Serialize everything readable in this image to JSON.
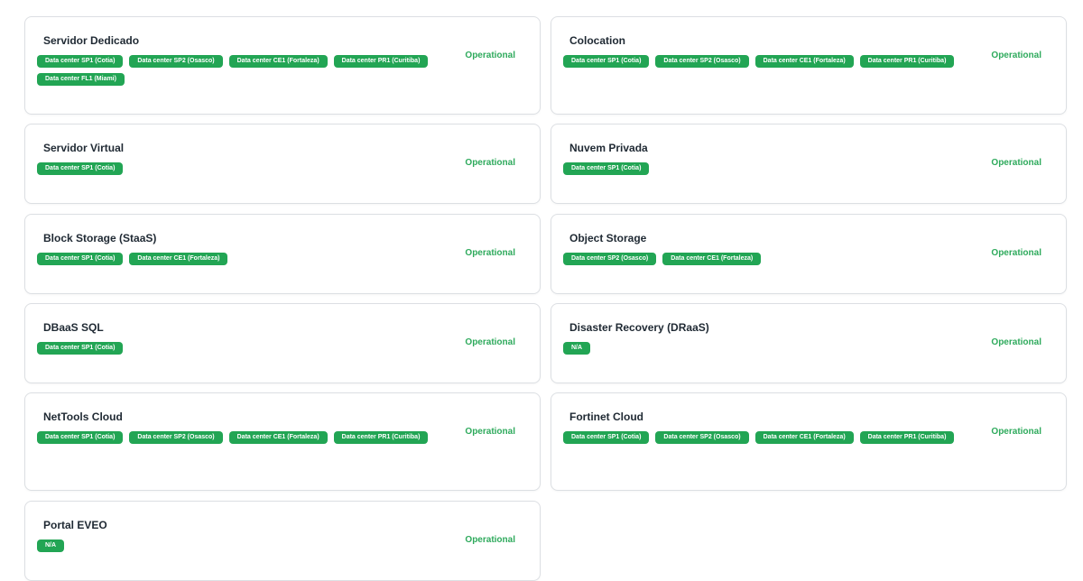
{
  "colors": {
    "operational": "#2eaa5c",
    "tag_bg": "#22a554",
    "card_border": "#dcdfe3"
  },
  "services": [
    {
      "name": "Servidor Dedicado",
      "status": "Operational",
      "locations": [
        "Data center SP1 (Cotia)",
        "Data center SP2 (Osasco)",
        "Data center CE1 (Fortaleza)",
        "Data center PR1 (Curitiba)",
        "Data center FL1 (Miami)"
      ]
    },
    {
      "name": "Colocation",
      "status": "Operational",
      "locations": [
        "Data center SP1 (Cotia)",
        "Data center SP2 (Osasco)",
        "Data center CE1 (Fortaleza)",
        "Data center PR1 (Curitiba)"
      ]
    },
    {
      "name": "Servidor Virtual",
      "status": "Operational",
      "locations": [
        "Data center SP1 (Cotia)"
      ]
    },
    {
      "name": "Nuvem Privada",
      "status": "Operational",
      "locations": [
        "Data center SP1 (Cotia)"
      ]
    },
    {
      "name": "Block Storage (StaaS)",
      "status": "Operational",
      "locations": [
        "Data center SP1 (Cotia)",
        "Data center CE1 (Fortaleza)"
      ]
    },
    {
      "name": "Object Storage",
      "status": "Operational",
      "locations": [
        "Data center SP2 (Osasco)",
        "Data center CE1 (Fortaleza)"
      ]
    },
    {
      "name": "DBaaS SQL",
      "status": "Operational",
      "locations": [
        "Data center SP1 (Cotia)"
      ]
    },
    {
      "name": "Disaster Recovery (DRaaS)",
      "status": "Operational",
      "locations": [
        "N/A"
      ]
    },
    {
      "name": "NetTools Cloud",
      "status": "Operational",
      "locations": [
        "Data center SP1 (Cotia)",
        "Data center SP2 (Osasco)",
        "Data center CE1 (Fortaleza)",
        "Data center PR1 (Curitiba)"
      ]
    },
    {
      "name": "Fortinet Cloud",
      "status": "Operational",
      "locations": [
        "Data center SP1 (Cotia)",
        "Data center SP2 (Osasco)",
        "Data center CE1 (Fortaleza)",
        "Data center PR1 (Curitiba)"
      ]
    },
    {
      "name": "Portal EVEO",
      "status": "Operational",
      "locations": [
        "N/A"
      ]
    }
  ]
}
